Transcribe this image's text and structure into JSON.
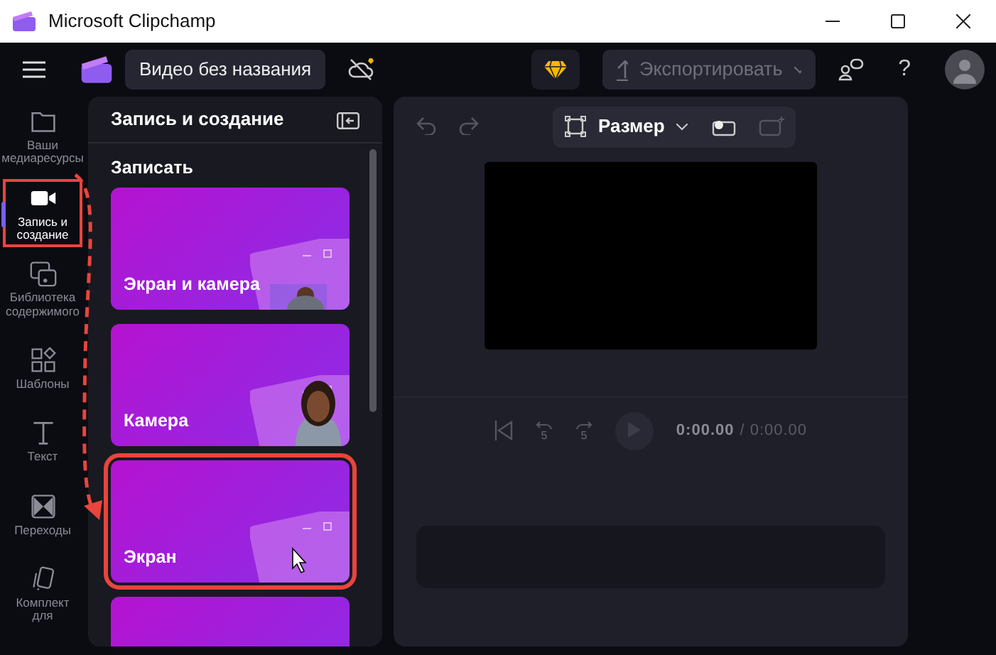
{
  "window": {
    "title": "Microsoft Clipchamp"
  },
  "topbar": {
    "project_title": "Видео без названия",
    "export_label": "Экспортировать",
    "export_disabled": true,
    "help_label": "?"
  },
  "rail": [
    {
      "label": "Ваши медиаресурсы",
      "kind": "folder",
      "selected": false,
      "annotated": false
    },
    {
      "label": "Запись и создание",
      "kind": "camera",
      "selected": true,
      "annotated": true
    },
    {
      "label": "Библиотека содержимого",
      "kind": "library",
      "selected": false,
      "annotated": false
    },
    {
      "label": "Шаблоны",
      "kind": "templates",
      "selected": false,
      "annotated": false
    },
    {
      "label": "Текст",
      "kind": "text",
      "selected": false,
      "annotated": false
    },
    {
      "label": "Переходы",
      "kind": "transitions",
      "selected": false,
      "annotated": false
    },
    {
      "label": "Комплект для",
      "kind": "kit",
      "selected": false,
      "annotated": false
    }
  ],
  "panel": {
    "title": "Запись и создание",
    "section": "Записать",
    "cards": [
      {
        "title": "Экран и камера",
        "kind": "screen-camera",
        "annotated": false
      },
      {
        "title": "Камера",
        "kind": "camera",
        "annotated": false
      },
      {
        "title": "Экран",
        "kind": "screen",
        "annotated": true
      },
      {
        "kind": "partial",
        "annotated": false
      }
    ]
  },
  "preview": {
    "size_label": "Размер",
    "rewind_label": "5",
    "forward_label": "5",
    "current_time": "0:00.00",
    "total_time": "/ 0:00.00"
  }
}
